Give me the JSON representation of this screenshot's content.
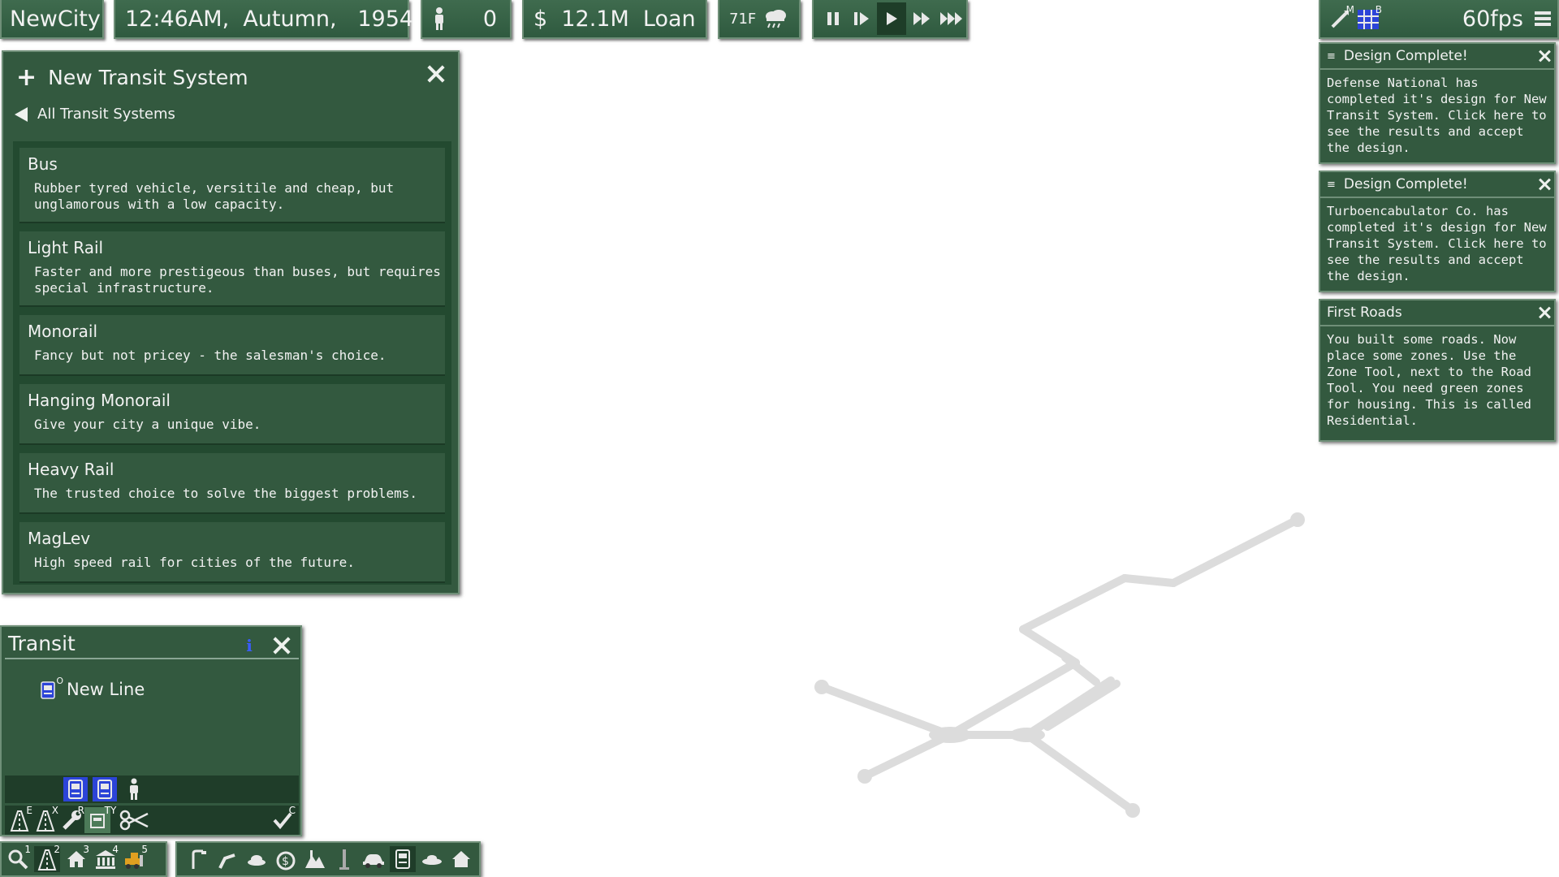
{
  "topbar": {
    "city": "NewCity",
    "datetime": "12:46AM,  Autumn,   1954",
    "population": "0",
    "money": "$  12.1M  Loan",
    "temperature": "71F",
    "fps": "60fps",
    "map_key_m": "M",
    "map_key_b": "B"
  },
  "transit_system_panel": {
    "title": "New  Transit  System",
    "back_label": "All  Transit  Systems",
    "items": [
      {
        "name": "Bus",
        "desc": "Rubber tyred vehicle, versitile and cheap, but\nunglamorous with a low capacity."
      },
      {
        "name": "Light  Rail",
        "desc": "Faster and more prestigeous than buses, but requires\nspecial infrastructure."
      },
      {
        "name": "Monorail",
        "desc": "Fancy but not pricey - the salesman's choice."
      },
      {
        "name": "Hanging  Monorail",
        "desc": "Give your city a unique vibe."
      },
      {
        "name": "Heavy  Rail",
        "desc": "The trusted choice to solve the biggest problems."
      },
      {
        "name": "MagLev",
        "desc": "High speed rail for cities of the future."
      }
    ]
  },
  "transit_panel": {
    "title": "Transit",
    "new_line": "New  Line",
    "new_line_key": "O",
    "tool_keys": [
      "E",
      "X",
      "R",
      "T",
      "Y",
      "C"
    ]
  },
  "bottom_toolbar": {
    "keys": [
      "1",
      "2",
      "3",
      "4",
      "5"
    ]
  },
  "notifications": [
    {
      "title": "Design Complete!",
      "body": "Defense National has\ncompleted it's design for New\nTransit System. Click here to\nsee the results and accept\nthe design."
    },
    {
      "title": "Design Complete!",
      "body": "Turboencabulator Co. has\ncompleted it's design for New\nTransit System. Click here to\nsee the results and accept\nthe design."
    },
    {
      "title": "First  Roads",
      "body": "You built some roads. Now\nplace some zones. Use the\nZone Tool, next to the Road\nTool. You need green zones\nfor housing. This is called\nResidential."
    }
  ],
  "colors": {
    "panel": "#33593f",
    "panel_dark": "#234a30",
    "border": "#6f8f78",
    "road": "#dcdcdc",
    "accent_blue": "#2c44d8"
  }
}
